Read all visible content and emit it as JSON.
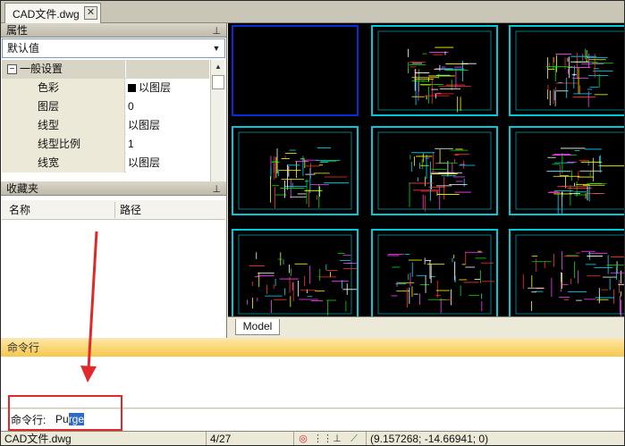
{
  "document_tab": {
    "title": "CAD文件.dwg",
    "close_glyph": "✕"
  },
  "properties_panel": {
    "title": "属性",
    "selector_value": "默认值",
    "group": {
      "expander": "−",
      "label": "一般设置"
    },
    "rows": [
      {
        "name": "色彩",
        "value": "以图层",
        "swatch_color": "#000000"
      },
      {
        "name": "图层",
        "value": "0"
      },
      {
        "name": "线型",
        "value": "以图层"
      },
      {
        "name": "线型比例",
        "value": "1"
      },
      {
        "name": "线宽",
        "value": "以图层"
      }
    ]
  },
  "favorites_panel": {
    "title": "收藏夹",
    "columns": [
      "名称",
      "路径"
    ]
  },
  "canvas": {
    "background": "#000000",
    "frame_color": "#00c8d8",
    "selected_frame_color": "#0a2ad8",
    "layout_tab": "Model"
  },
  "command": {
    "header": "命令行",
    "prompt": "命令行:",
    "input_typed": "Pu",
    "input_selected": "rge"
  },
  "annotation": {
    "color": "#e02a2a"
  },
  "status_bar": {
    "file_name": "CAD文件.dwg",
    "page": "4/27",
    "coordinates": "(9.157268; -14.66941; 0)",
    "icons": [
      "snap-icon",
      "grid-icon",
      "ortho-icon",
      "polar-icon"
    ]
  }
}
